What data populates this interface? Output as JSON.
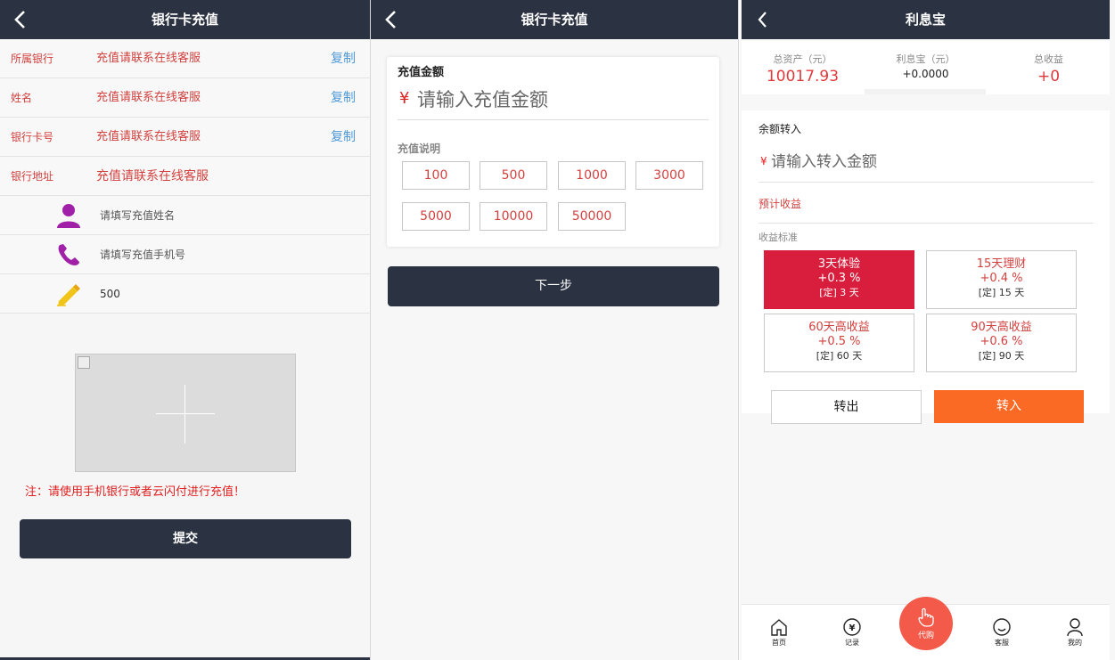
{
  "screen1": {
    "title": "银行卡充值",
    "rows": [
      {
        "label": "所属银行",
        "value": "充值请联系在线客服",
        "copy": "复制"
      },
      {
        "label": "姓名",
        "value": "充值请联系在线客服",
        "copy": "复制"
      },
      {
        "label": "银行卡号",
        "value": "充值请联系在线客服",
        "copy": "复制"
      },
      {
        "label": "银行地址",
        "value": "充值请联系在线客服"
      }
    ],
    "name_placeholder": "请填写充值姓名",
    "phone_placeholder": "请填写充值手机号",
    "amount_value": "500",
    "note": "注：请使用手机银行或者云闪付进行充值！",
    "submit": "提交",
    "colors": {
      "dark": "#2b3242",
      "red": "#d2413e",
      "blue": "#4f9ad8"
    },
    "icons": [
      "back-chevron-icon",
      "user-icon",
      "phone-icon",
      "pencil-icon",
      "broken-image-icon"
    ]
  },
  "screen2": {
    "title": "银行卡充值",
    "amount_heading": "充值金额",
    "currency": "¥",
    "amount_placeholder": "请输入充值金额",
    "desc_heading": "充值说明",
    "amounts": [
      "100",
      "500",
      "1000",
      "3000",
      "5000",
      "10000",
      "50000"
    ],
    "next": "下一步"
  },
  "screen3": {
    "title": "利息宝",
    "stats": [
      {
        "label": "总资产（元）",
        "value": "10017.93"
      },
      {
        "label": "利息宝（元）",
        "value": "+0.0000"
      },
      {
        "label": "总收益",
        "value": "+0"
      }
    ],
    "transfer_heading": "余额转入",
    "currency": "¥",
    "amount_placeholder": "请输入转入金额",
    "estimate": "预计收益",
    "standard": "收益标准",
    "plans": [
      {
        "name": "3天体验",
        "rate": "+0.3 %",
        "term": "[定] 3 天",
        "selected": true
      },
      {
        "name": "15天理财",
        "rate": "+0.4 %",
        "term": "[定] 15 天",
        "selected": false
      },
      {
        "name": "60天高收益",
        "rate": "+0.5 %",
        "term": "[定] 60 天",
        "selected": false
      },
      {
        "name": "90天高收益",
        "rate": "+0.6 %",
        "term": "[定] 90 天",
        "selected": false
      }
    ],
    "transfer_out": "转出",
    "transfer_in": "转入",
    "tabs": [
      {
        "label": "首页",
        "icon": "home-icon"
      },
      {
        "label": "记录",
        "icon": "yen-record-icon"
      },
      {
        "label": "代购",
        "icon": "hand-icon"
      },
      {
        "label": "客服",
        "icon": "smile-icon"
      },
      {
        "label": "我的",
        "icon": "person-icon"
      }
    ],
    "colors": {
      "accent": "#fb6a24",
      "selected": "#d81e3c",
      "center_tab": "#f35a4a"
    }
  }
}
